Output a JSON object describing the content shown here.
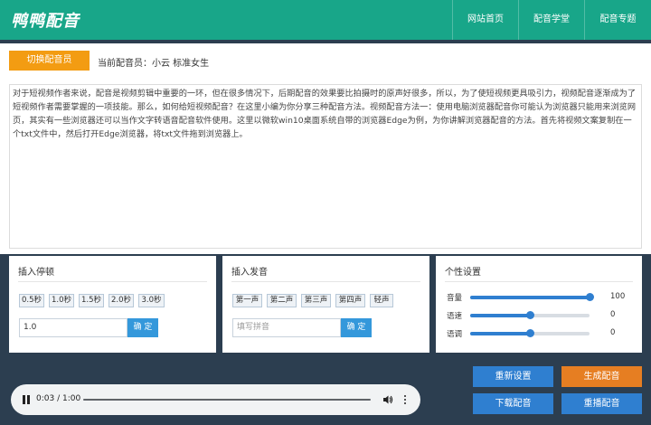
{
  "header": {
    "logo": "鸭鸭配音",
    "nav": [
      "网站首页",
      "配音学堂",
      "配音专题"
    ]
  },
  "voice": {
    "switch_label": "切换配音员",
    "current": "当前配音员：小云 标准女生"
  },
  "editor": {
    "text": "对于短视频作者来说，配音是视频剪辑中重要的一环，但在很多情况下，后期配音的效果要比拍摄时的原声好很多，所以，为了使短视频更具吸引力，视频配音逐渐成为了短视频作者需要掌握的一项技能。那么，如何给短视频配音？在这里小编为你分享三种配音方法。视频配音方法一：使用电脑浏览器配音你可能认为浏览器只能用来浏览网页，其实有一些浏览器还可以当作文字转语音配音软件使用。这里以微软win10桌面系统自带的浏览器Edge为例，为你讲解浏览器配音的方法。首先将视频文案复制在一个txt文件中，然后打开Edge浏览器，将txt文件拖到浏览器上。"
  },
  "pause_card": {
    "title": "插入停顿",
    "chips": [
      "0.5秒",
      "1.0秒",
      "1.5秒",
      "2.0秒",
      "3.0秒"
    ],
    "input_value": "1.0",
    "confirm": "确 定"
  },
  "pron_card": {
    "title": "插入发音",
    "chips": [
      "第一声",
      "第二声",
      "第三声",
      "第四声",
      "轻声"
    ],
    "input_placeholder": "填写拼音",
    "confirm": "确 定"
  },
  "settings_card": {
    "title": "个性设置",
    "sliders": [
      {
        "label": "音量",
        "value": 100,
        "fraction": 1.0
      },
      {
        "label": "语速",
        "value": 0,
        "fraction": 0.5
      },
      {
        "label": "语调",
        "value": 0,
        "fraction": 0.5
      }
    ]
  },
  "player": {
    "time": "0:03 / 1:00"
  },
  "actions": {
    "reset": "重新设置",
    "generate": "生成配音",
    "download": "下载配音",
    "replay": "重播配音"
  },
  "colors": {
    "header": "#18a689",
    "accent_orange": "#f39c12",
    "accent_blue": "#2f7fd0",
    "background": "#2c3e50"
  }
}
